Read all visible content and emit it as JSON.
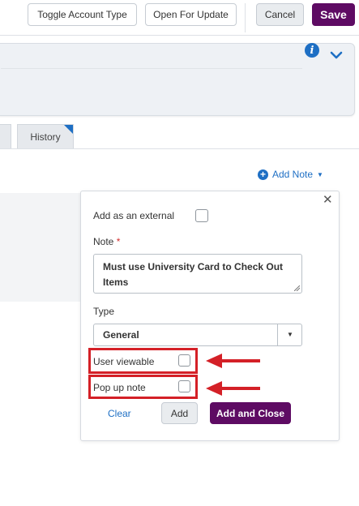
{
  "toolbar": {
    "toggle_label": "Toggle Account Type",
    "open_label": "Open For Update",
    "cancel_label": "Cancel",
    "save_label": "Save"
  },
  "tabs": {
    "history_label": "History"
  },
  "notes": {
    "add_note_label": "Add Note"
  },
  "note_form": {
    "external_label": "Add as an external",
    "note_label": "Note",
    "required_marker": "*",
    "note_value": "Must use University Card to Check Out Items",
    "type_label": "Type",
    "type_value": "General",
    "user_viewable_label": "User viewable",
    "popup_label": "Pop up note",
    "clear_label": "Clear",
    "add_label": "Add",
    "add_close_label": "Add and Close",
    "external_checked": false,
    "user_viewable_checked": false,
    "popup_checked": false
  },
  "colors": {
    "primary": "#5e0b63",
    "accent_blue": "#1e6fc4",
    "highlight_red": "#d42027"
  },
  "icons": {
    "info": "info-icon",
    "chevron": "chevron-down-icon",
    "close": "close-icon",
    "add": "plus-circle-icon"
  }
}
